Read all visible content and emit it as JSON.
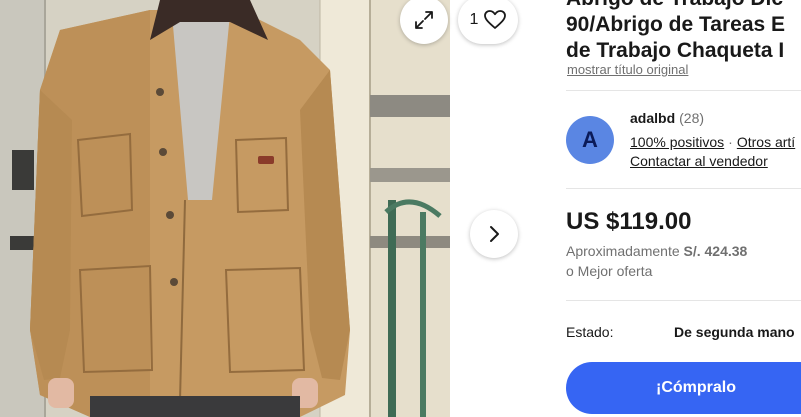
{
  "gallery": {
    "watch_count": "1",
    "expand_icon": "expand-arrows-icon",
    "watch_icon": "heart-icon",
    "next_icon": "chevron-right-icon"
  },
  "listing": {
    "title_lines": [
      "Abrigo de Trabajo Dic",
      "90/Abrigo de Tareas E",
      "de Trabajo Chaqueta I"
    ],
    "show_original_title": "mostrar título original"
  },
  "seller": {
    "avatar_letter": "A",
    "name": "adalbd",
    "score": "(28)",
    "positive": "100% positivos",
    "separator": "·",
    "other_items": "Otros artí",
    "contact": "Contactar al vendedor"
  },
  "pricing": {
    "price": "US $119.00",
    "approx_label": "Aproximadamente",
    "approx_value": "S/. 424.38",
    "best_offer": "o Mejor oferta"
  },
  "condition": {
    "label": "Estado:",
    "value": "De segunda mano"
  },
  "actions": {
    "buy_now": "¡Cómpralo"
  },
  "colors": {
    "buy_button": "#3665f3",
    "avatar": "#5a86e3",
    "muted_text": "#707070"
  }
}
